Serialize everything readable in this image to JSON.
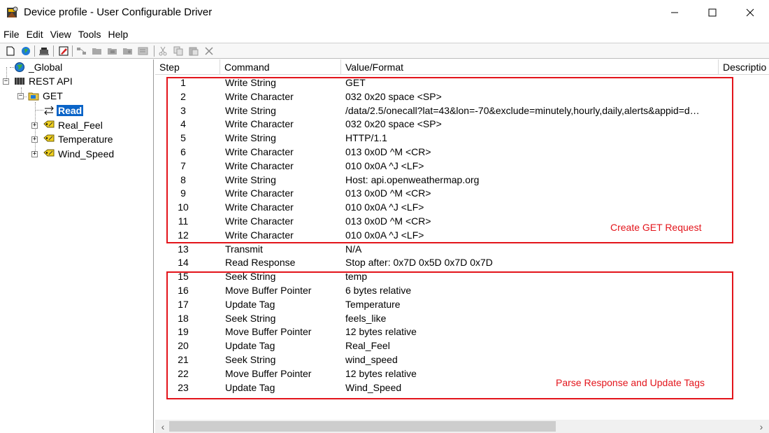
{
  "window": {
    "title": "Device profile - User Configurable Driver",
    "app_icon": "kepware-driver-icon",
    "controls": {
      "minimize": "minimize-icon",
      "maximize": "maximize-icon",
      "close": "close-icon"
    }
  },
  "menu": [
    "File",
    "Edit",
    "View",
    "Tools",
    "Help"
  ],
  "toolbar": [
    "new-icon",
    "globe-icon",
    "device-icon",
    "edit-icon",
    "network-icon",
    "folder-icon",
    "folder-icon",
    "folder-icon",
    "properties-icon",
    "cut-icon",
    "copy-icon",
    "paste-icon",
    "delete-icon"
  ],
  "tree": {
    "global": "_Global",
    "rest_api": "REST API",
    "get": "GET",
    "read": "Read",
    "real_feel": "Real_Feel",
    "temperature": "Temperature",
    "wind_speed": "Wind_Speed"
  },
  "grid": {
    "columns": [
      "Step",
      "Command",
      "Value/Format",
      "Descriptio"
    ],
    "rows": [
      {
        "step": "1",
        "command": "Write String",
        "value": "GET"
      },
      {
        "step": "2",
        "command": "Write Character",
        "value": "032  0x20  space  <SP>"
      },
      {
        "step": "3",
        "command": "Write String",
        "value": "/data/2.5/onecall?lat=43&lon=-70&exclude=minutely,hourly,daily,alerts&appid=d…"
      },
      {
        "step": "4",
        "command": "Write Character",
        "value": "032  0x20  space  <SP>"
      },
      {
        "step": "5",
        "command": "Write String",
        "value": "HTTP/1.1"
      },
      {
        "step": "6",
        "command": "Write Character",
        "value": "013  0x0D  ^M  <CR>"
      },
      {
        "step": "7",
        "command": "Write Character",
        "value": "010  0x0A  ^J  <LF>"
      },
      {
        "step": "8",
        "command": "Write String",
        "value": "Host: api.openweathermap.org"
      },
      {
        "step": "9",
        "command": "Write Character",
        "value": "013  0x0D  ^M  <CR>"
      },
      {
        "step": "10",
        "command": "Write Character",
        "value": "010  0x0A  ^J  <LF>"
      },
      {
        "step": "11",
        "command": "Write Character",
        "value": "013  0x0D  ^M  <CR>"
      },
      {
        "step": "12",
        "command": "Write Character",
        "value": "010  0x0A  ^J  <LF>"
      },
      {
        "step": "13",
        "command": "Transmit",
        "value": "N/A"
      },
      {
        "step": "14",
        "command": "Read Response",
        "value": "Stop after: 0x7D 0x5D 0x7D 0x7D"
      },
      {
        "step": "15",
        "command": "Seek String",
        "value": "temp"
      },
      {
        "step": "16",
        "command": "Move Buffer Pointer",
        "value": "6 bytes relative"
      },
      {
        "step": "17",
        "command": "Update Tag",
        "value": "Temperature"
      },
      {
        "step": "18",
        "command": "Seek String",
        "value": "feels_like"
      },
      {
        "step": "19",
        "command": "Move Buffer Pointer",
        "value": "12 bytes relative"
      },
      {
        "step": "20",
        "command": "Update Tag",
        "value": "Real_Feel"
      },
      {
        "step": "21",
        "command": "Seek String",
        "value": "wind_speed"
      },
      {
        "step": "22",
        "command": "Move Buffer Pointer",
        "value": "12 bytes relative"
      },
      {
        "step": "23",
        "command": "Update Tag",
        "value": "Wind_Speed"
      }
    ]
  },
  "annotations": {
    "get_request": "Create GET Request",
    "parse_response": "Parse Response and Update Tags",
    "color": "#e3141b"
  }
}
